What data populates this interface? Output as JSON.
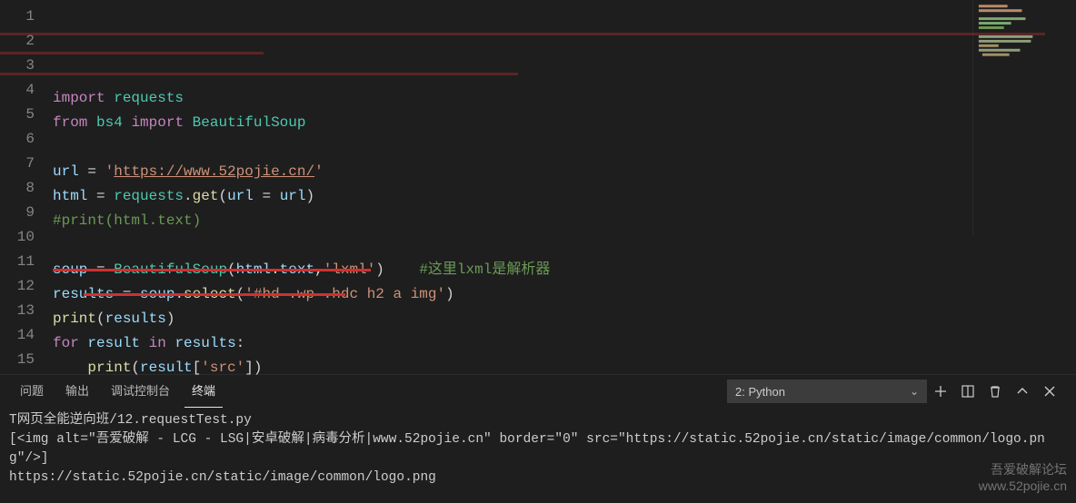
{
  "editor": {
    "lines": [
      {
        "n": "1",
        "tokens": [
          [
            "kw",
            "import"
          ],
          [
            "op",
            " "
          ],
          [
            "module",
            "requests"
          ]
        ]
      },
      {
        "n": "2",
        "tokens": [
          [
            "kw",
            "from"
          ],
          [
            "op",
            " "
          ],
          [
            "module",
            "bs4"
          ],
          [
            "op",
            " "
          ],
          [
            "kw",
            "import"
          ],
          [
            "op",
            " "
          ],
          [
            "module",
            "BeautifulSoup"
          ]
        ]
      },
      {
        "n": "3",
        "tokens": [
          [
            "op",
            ""
          ]
        ]
      },
      {
        "n": "4",
        "tokens": [
          [
            "var",
            "url"
          ],
          [
            "op",
            " = "
          ],
          [
            "str",
            "'"
          ],
          [
            "underline-str",
            "https://www.52pojie.cn/"
          ],
          [
            "str",
            "'"
          ]
        ]
      },
      {
        "n": "5",
        "tokens": [
          [
            "var",
            "html"
          ],
          [
            "op",
            " = "
          ],
          [
            "module",
            "requests"
          ],
          [
            "op",
            "."
          ],
          [
            "func",
            "get"
          ],
          [
            "op",
            "("
          ],
          [
            "var",
            "url"
          ],
          [
            "op",
            " = "
          ],
          [
            "var",
            "url"
          ],
          [
            "op",
            ")"
          ]
        ]
      },
      {
        "n": "6",
        "tokens": [
          [
            "cmt",
            "#print(html.text)"
          ]
        ]
      },
      {
        "n": "7",
        "tokens": [
          [
            "op",
            ""
          ]
        ]
      },
      {
        "n": "8",
        "tokens": [
          [
            "var",
            "soup"
          ],
          [
            "op",
            " = "
          ],
          [
            "module",
            "BeautifulSoup"
          ],
          [
            "op",
            "("
          ],
          [
            "var",
            "html"
          ],
          [
            "op",
            "."
          ],
          [
            "var",
            "text"
          ],
          [
            "op",
            ","
          ],
          [
            "str",
            "'lxml'"
          ],
          [
            "op",
            ")    "
          ],
          [
            "cmt",
            "#这里lxml是解析器"
          ]
        ]
      },
      {
        "n": "9",
        "tokens": [
          [
            "var",
            "results"
          ],
          [
            "op",
            " = "
          ],
          [
            "var",
            "soup"
          ],
          [
            "op",
            "."
          ],
          [
            "func",
            "select"
          ],
          [
            "op",
            "("
          ],
          [
            "str",
            "'#hd .wp .hdc h2 a img'"
          ],
          [
            "op",
            ")"
          ]
        ]
      },
      {
        "n": "10",
        "tokens": [
          [
            "func",
            "print"
          ],
          [
            "op",
            "("
          ],
          [
            "var",
            "results"
          ],
          [
            "op",
            ")"
          ]
        ]
      },
      {
        "n": "11",
        "tokens": [
          [
            "kw",
            "for"
          ],
          [
            "op",
            " "
          ],
          [
            "var",
            "result"
          ],
          [
            "op",
            " "
          ],
          [
            "kw",
            "in"
          ],
          [
            "op",
            " "
          ],
          [
            "var",
            "results"
          ],
          [
            "op",
            ":"
          ]
        ]
      },
      {
        "n": "12",
        "tokens": [
          [
            "op",
            "    "
          ],
          [
            "func",
            "print"
          ],
          [
            "op",
            "("
          ],
          [
            "var",
            "result"
          ],
          [
            "op",
            "["
          ],
          [
            "str",
            "'src'"
          ],
          [
            "op",
            "])"
          ]
        ]
      },
      {
        "n": "13",
        "tokens": [
          [
            "op",
            ""
          ]
        ]
      },
      {
        "n": "14",
        "tokens": [
          [
            "op",
            ""
          ]
        ]
      },
      {
        "n": "15",
        "tokens": [
          [
            "op",
            ""
          ]
        ]
      }
    ]
  },
  "panel": {
    "tabs": {
      "problems": "问题",
      "output": "输出",
      "debug_console": "调试控制台",
      "terminal": "终端"
    },
    "launcher_label": "2: Python",
    "terminal_lines": [
      "T网页全能逆向班/12.requestTest.py",
      "[<img alt=\"吾爱破解 - LCG - LSG|安卓破解|病毒分析|www.52pojie.cn\" border=\"0\" src=\"https://static.52pojie.cn/static/image/common/logo.png\"/>]",
      "https://static.52pojie.cn/static/image/common/logo.png"
    ]
  },
  "watermark": {
    "line1": "吾爱破解论坛",
    "line2": "www.52pojie.cn"
  }
}
